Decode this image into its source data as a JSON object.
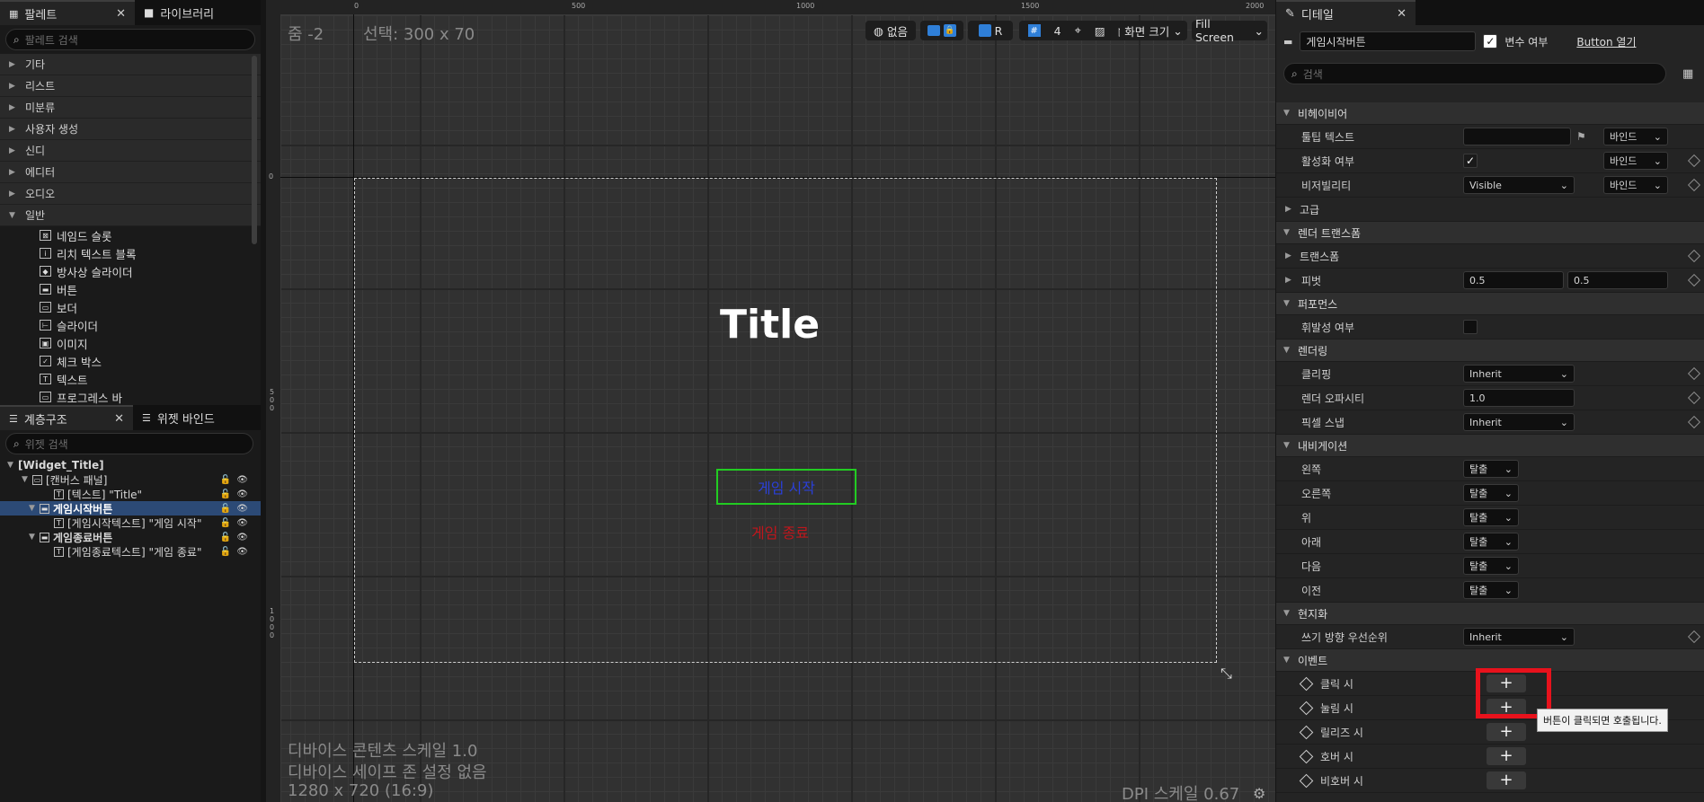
{
  "palette": {
    "tab_label": "팔레트",
    "close": "✕",
    "library_tab": "라이브러리",
    "search_placeholder": "팔레트 검색",
    "categories": [
      "기타",
      "리스트",
      "미분류",
      "사용자 생성",
      "신디",
      "에디터",
      "오디오",
      "일반"
    ],
    "items": [
      {
        "icon": "⊠",
        "label": "네임드 슬롯"
      },
      {
        "icon": "i",
        "label": "리치 텍스트 블록"
      },
      {
        "icon": "◆",
        "label": "방사상 슬라이더"
      },
      {
        "icon": "▬",
        "label": "버튼"
      },
      {
        "icon": "▭",
        "label": "보더"
      },
      {
        "icon": "⊢",
        "label": "슬라이더"
      },
      {
        "icon": "▣",
        "label": "이미지"
      },
      {
        "icon": "✓",
        "label": "체크 박스"
      },
      {
        "icon": "T",
        "label": "텍스트"
      },
      {
        "icon": "▭",
        "label": "프로그레스 바"
      }
    ]
  },
  "hierarchy": {
    "tab_label": "계층구조",
    "close": "✕",
    "binding_tab": "위젯 바인드",
    "search_placeholder": "위젯 검색",
    "root": "[Widget_Title]",
    "nodes": [
      {
        "label": "[캔버스 패널]"
      },
      {
        "label": "[텍스트] \"Title\""
      },
      {
        "label": "게임시작버튼"
      },
      {
        "label": "[게임시작텍스트] \"게임 시작\""
      },
      {
        "label": "게임종료버튼"
      },
      {
        "label": "[게임종료텍스트] \"게임 종료\""
      }
    ]
  },
  "viewport": {
    "zoom": "줌 -2",
    "selection": "선택: 300 x 70",
    "ruler_top": [
      "0",
      "500",
      "1000",
      "1500",
      "2000"
    ],
    "ruler_left": [
      "0",
      "5\n0\n0",
      "1\n0\n0\n0"
    ],
    "toolbar": {
      "none": "없음",
      "r": "R",
      "grid_num": "4",
      "screen_size": "화면 크기",
      "fill_screen": "Fill Screen"
    },
    "canvas_title": "Title",
    "start_button_text": "게임 시작",
    "exit_button_text": "게임 종료",
    "info_line1": "디바이스 콘텐츠 스케일 1.0",
    "info_line2": "디바이스 세이프 존 설정 없음",
    "info_line3": "1280 x 720 (16:9)",
    "dpi": "DPI 스케일 0.67",
    "colors": {
      "title": "#ffffff",
      "start_text": "#2a3fd8",
      "exit_text": "#c0161c",
      "selection_border": "#22cc22"
    }
  },
  "details": {
    "tab_label": "디테일",
    "close": "✕",
    "name_value": "게임시작버튼",
    "is_variable_label": "변수 여부",
    "open_button": "Button 열기",
    "search_placeholder": "검색",
    "sections": {
      "behavior": "비헤이비어",
      "render_transform": "렌더 트랜스폼",
      "performance": "퍼포먼스",
      "rendering": "렌더링",
      "navigation": "내비게이션",
      "localization": "현지화",
      "events": "이벤트"
    },
    "props": {
      "tooltip": "툴팁 텍스트",
      "enabled": "활성화 여부",
      "visibility": "비저빌리티",
      "visibility_value": "Visible",
      "advanced": "고급",
      "transform": "트랜스폼",
      "pivot": "피벗",
      "pivot_x": "0.5",
      "pivot_y": "0.5",
      "volatile": "휘발성 여부",
      "clipping": "클리핑",
      "clipping_value": "Inherit",
      "opacity": "렌더 오파시티",
      "opacity_value": "1.0",
      "pixel_snap": "픽셀 스냅",
      "pixel_snap_value": "Inherit",
      "bind": "바인드",
      "write_dir": "쓰기 방향 우선순위",
      "write_dir_value": "Inherit"
    },
    "nav": [
      {
        "label": "왼쪽",
        "value": "탈출"
      },
      {
        "label": "오른쪽",
        "value": "탈출"
      },
      {
        "label": "위",
        "value": "탈출"
      },
      {
        "label": "아래",
        "value": "탈출"
      },
      {
        "label": "다음",
        "value": "탈출"
      },
      {
        "label": "이전",
        "value": "탈출"
      }
    ],
    "events": [
      {
        "label": "클릭 시"
      },
      {
        "label": "눌림 시"
      },
      {
        "label": "릴리즈 시"
      },
      {
        "label": "호버 시"
      },
      {
        "label": "비호버 시"
      }
    ],
    "tooltip_popup": "버튼이 클릭되면 호출됩니다.",
    "highlight_color": "#e8121c"
  }
}
